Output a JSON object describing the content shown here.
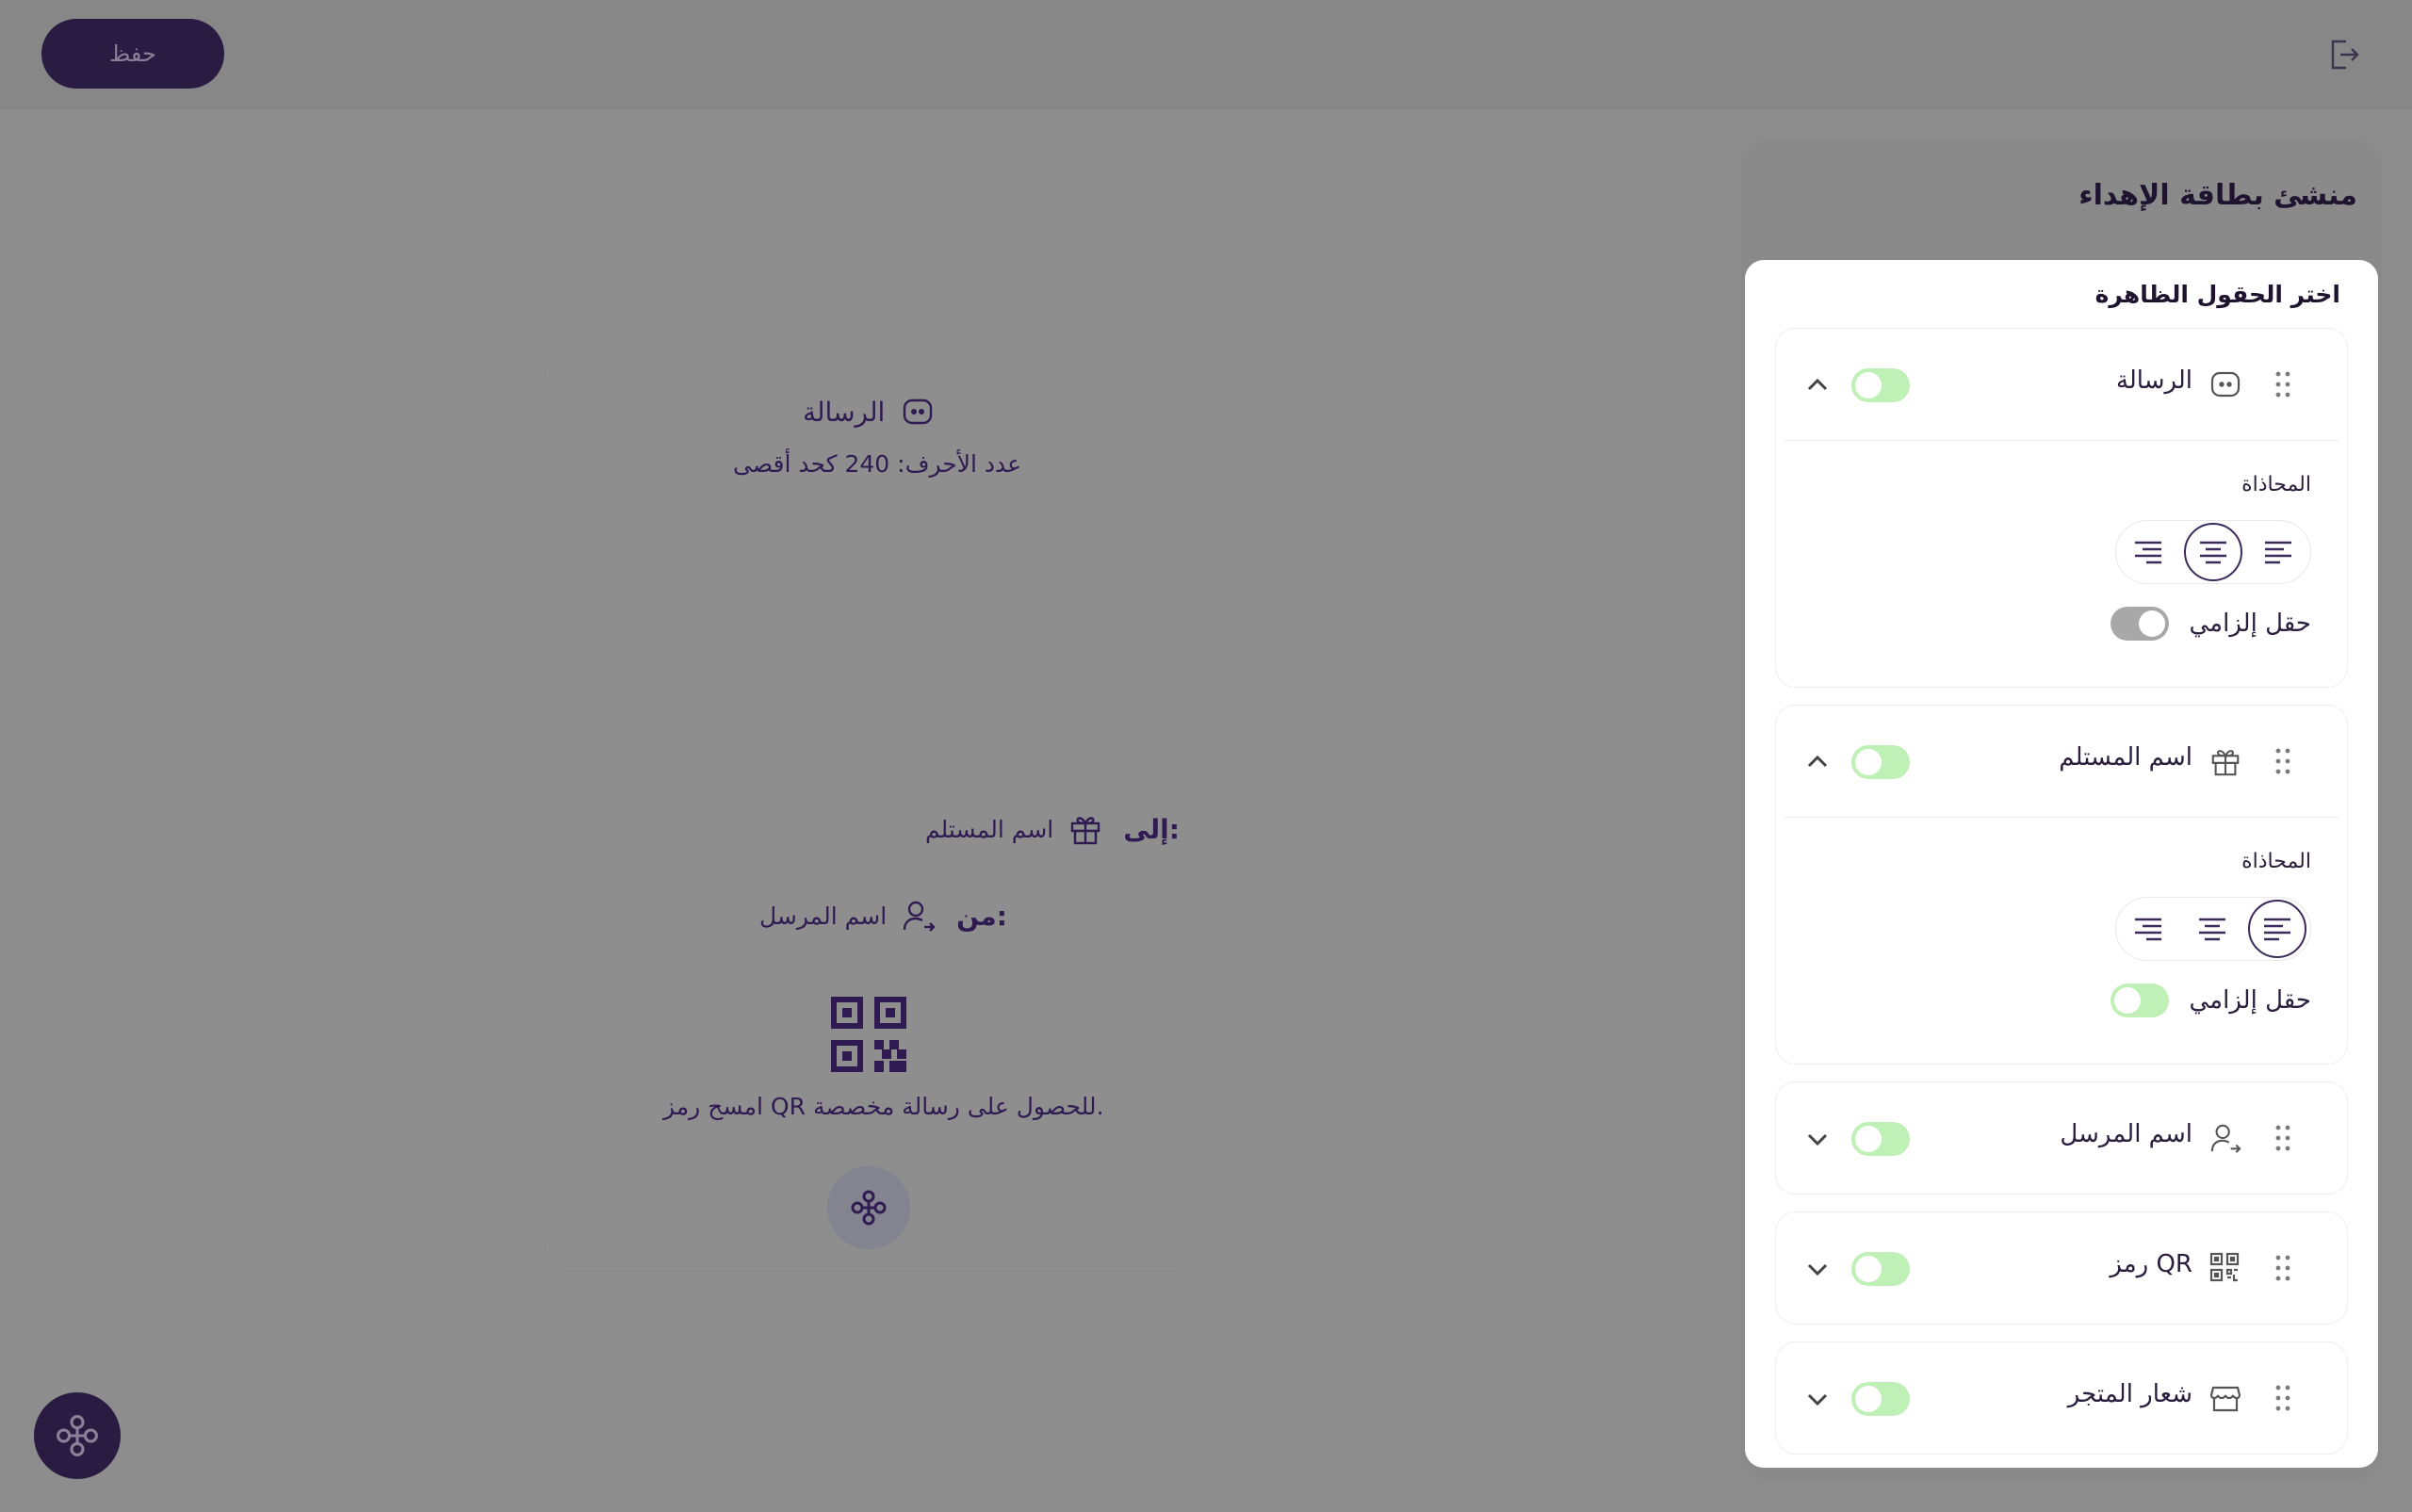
{
  "toolbar": {
    "save_label": "حفظ"
  },
  "preview": {
    "message_title": "الرسالة",
    "message_limit": "عدد الأحرف: 240 كحد أقصى",
    "to_label": "إلى:",
    "recipient": "اسم المستلم",
    "from_label": "من:",
    "sender": "اسم المرسل",
    "qr_caption": "امسح رمز QR للحصول على رسالة مخصصة."
  },
  "panel": {
    "title": "منشئ بطاقة الإهداء",
    "subtitle": "اختر الحقول الظاهرة",
    "align_label": "المحاذاة",
    "required_label": "حقل إلزامي",
    "fields": [
      {
        "label": "الرسالة",
        "icon": "message-icon",
        "expanded": true,
        "required": false
      },
      {
        "label": "اسم المستلم",
        "icon": "gift-icon",
        "expanded": true,
        "required": true
      },
      {
        "label": "اسم المرسل",
        "icon": "user-share-icon",
        "expanded": false
      },
      {
        "label": "رمز QR",
        "icon": "qr-icon",
        "expanded": false
      },
      {
        "label": "شعار المتجر",
        "icon": "store-icon",
        "expanded": false
      }
    ]
  },
  "colors": {
    "accent": "#2f1b52",
    "toggle_on": "#bff0b6",
    "toggle_off": "#a8a8a8"
  }
}
